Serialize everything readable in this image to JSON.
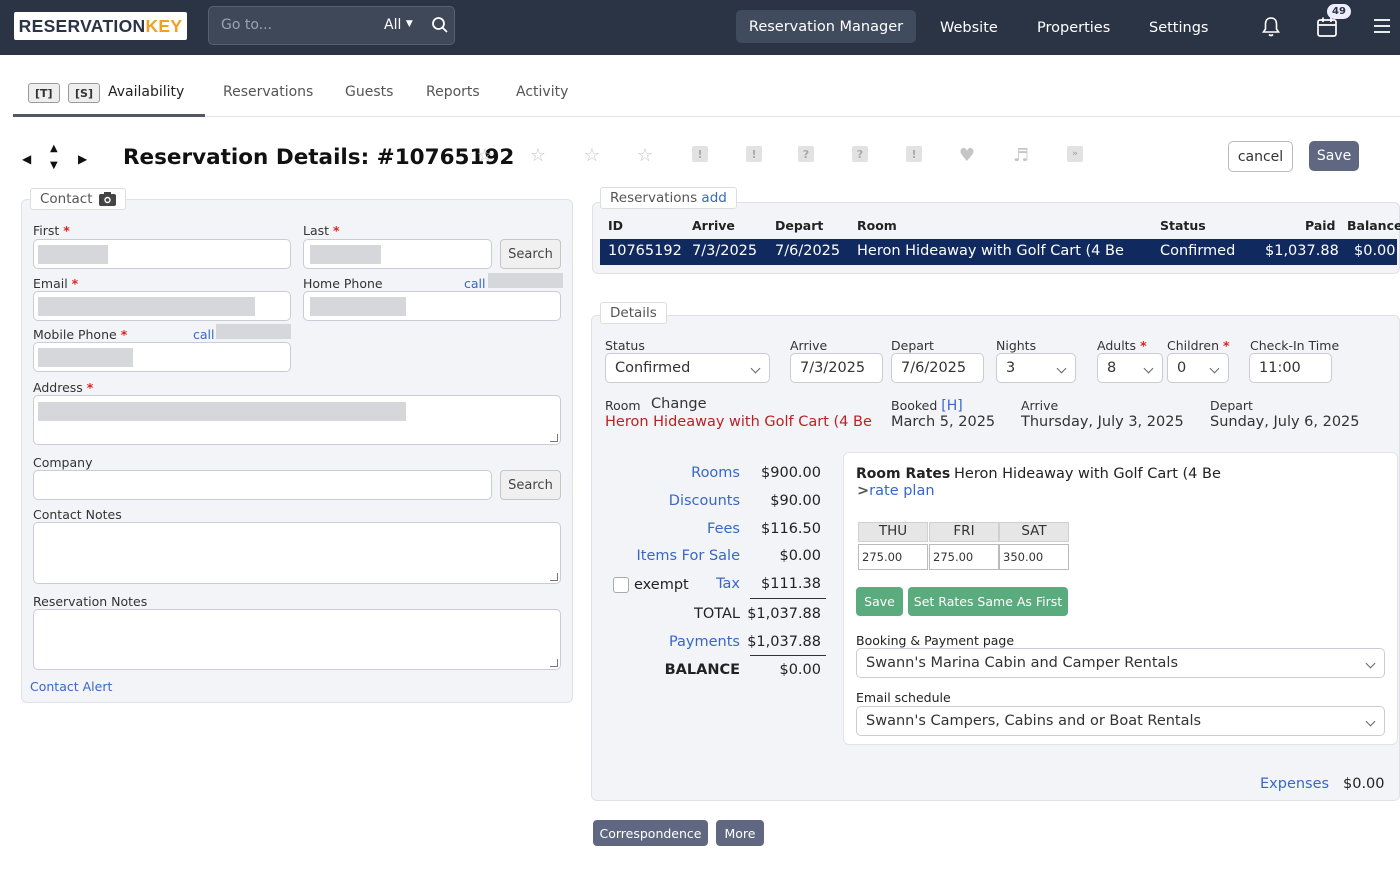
{
  "topbar": {
    "logo_part1": "RESERVATION",
    "logo_part2": "KEY",
    "goto_placeholder": "Go to...",
    "goto_scope": "All",
    "nav": [
      "Reservation Manager",
      "Website",
      "Properties",
      "Settings"
    ],
    "cal_badge": "49"
  },
  "tabs": {
    "kbd1": "[T]",
    "kbd2": "[S]",
    "items": [
      "Availability",
      "Reservations",
      "Guests",
      "Reports",
      "Activity"
    ]
  },
  "title": "Reservation Details: #10765192",
  "actions": {
    "cancel": "cancel",
    "save": "Save"
  },
  "contact": {
    "legend": "Contact",
    "first": "First",
    "last": "Last",
    "search": "Search",
    "email": "Email",
    "home_phone": "Home Phone",
    "call": "call",
    "mobile_phone": "Mobile Phone",
    "address": "Address",
    "company": "Company",
    "contact_notes": "Contact Notes",
    "reservation_notes": "Reservation Notes",
    "contact_alert": "Contact Alert"
  },
  "reservations": {
    "legend": "Reservations",
    "add": "add",
    "headers": [
      "ID",
      "Arrive",
      "Depart",
      "Room",
      "Status",
      "Paid",
      "Balance"
    ],
    "row": [
      "10765192",
      "7/3/2025",
      "7/6/2025",
      "Heron Hideaway with Golf Cart (4 Be",
      "Confirmed",
      "$1,037.88",
      "$0.00"
    ]
  },
  "details": {
    "legend": "Details",
    "status_label": "Status",
    "status_value": "Confirmed",
    "arrive_label": "Arrive",
    "arrive_value": "7/3/2025",
    "depart_label": "Depart",
    "depart_value": "7/6/2025",
    "nights_label": "Nights",
    "nights_value": "3",
    "adults_label": "Adults",
    "adults_value": "8",
    "children_label": "Children",
    "children_value": "0",
    "checkin_label": "Check-In Time",
    "checkin_value": "11:00",
    "room_label": "Room",
    "change": "Change",
    "room_name": "Heron Hideaway with Golf Cart (4 Be",
    "booked_label": "Booked",
    "booked_h": "[H]",
    "booked_date": "March 5, 2025",
    "arrive2_label": "Arrive",
    "arrive2_date": "Thursday, July 3, 2025",
    "depart2_label": "Depart",
    "depart2_date": "Sunday, July 6, 2025"
  },
  "totals": {
    "rooms_label": "Rooms",
    "rooms": "$900.00",
    "discounts_label": "Discounts",
    "discounts": "$90.00",
    "fees_label": "Fees",
    "fees": "$116.50",
    "items_label": "Items For Sale",
    "items": "$0.00",
    "exempt": "exempt",
    "tax_label": "Tax",
    "tax": "$111.38",
    "total_label": "TOTAL",
    "total": "$1,037.88",
    "payments_label": "Payments",
    "payments": "$1,037.88",
    "balance_label": "BALANCE",
    "balance": "$0.00"
  },
  "rates": {
    "title": "Room Rates",
    "room": "Heron Hideaway with Golf Cart (4 Be",
    "rate_plan": "rate plan",
    "days": [
      "THU",
      "FRI",
      "SAT"
    ],
    "values": [
      "275.00",
      "275.00",
      "350.00"
    ],
    "save": "Save",
    "same": "Set Rates Same As First",
    "booking_label": "Booking & Payment page",
    "booking_value": "Swann's Marina Cabin and Camper Rentals",
    "email_label": "Email schedule",
    "email_value": "Swann's Campers, Cabins and or Boat Rentals"
  },
  "expenses": {
    "label": "Expenses",
    "value": "$0.00"
  },
  "bottom": {
    "correspondence": "Correspondence",
    "more": "More"
  }
}
